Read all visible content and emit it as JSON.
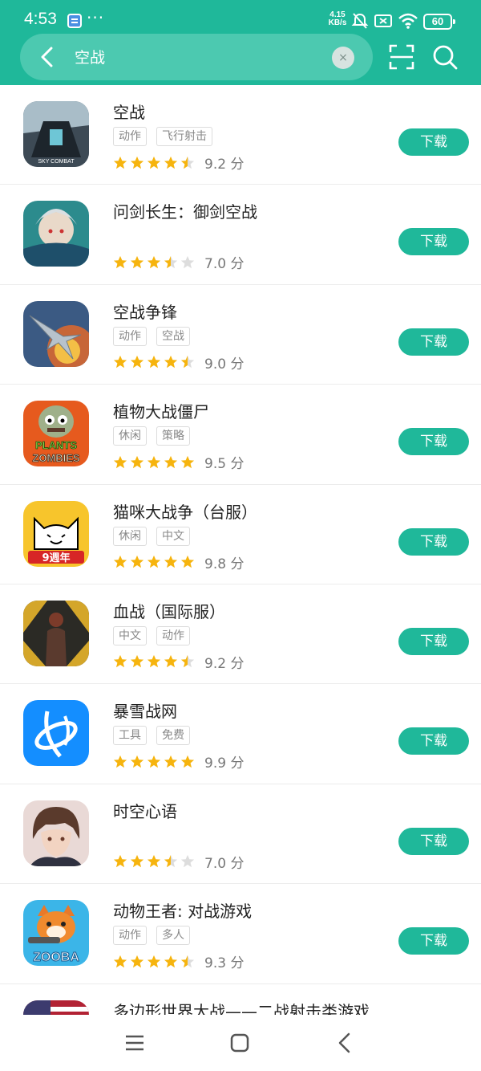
{
  "status_bar": {
    "time": "4:53",
    "dots": "···",
    "net_speed_value": "4.15",
    "net_speed_unit": "KB/s",
    "battery": "60"
  },
  "search": {
    "query": "空战",
    "clear_label": "×"
  },
  "colors": {
    "accent": "#1fb89a",
    "star_filled": "#f6b40e",
    "star_empty": "#dddddd"
  },
  "apps": [
    {
      "name": "空战",
      "tags": [
        "动作",
        "飞行射击"
      ],
      "rating_stars": 4.5,
      "score": "9.2 分",
      "button": "下载",
      "icon": "sky-combat-icon"
    },
    {
      "name": "问剑长生：御剑空战",
      "tags": [],
      "rating_stars": 3.5,
      "score": "7.0 分",
      "button": "下载",
      "icon": "wenjian-icon"
    },
    {
      "name": "空战争锋",
      "tags": [
        "动作",
        "空战"
      ],
      "rating_stars": 4.5,
      "score": "9.0 分",
      "button": "下载",
      "icon": "jet-fighter-icon"
    },
    {
      "name": "植物大战僵尸",
      "tags": [
        "休闲",
        "策略"
      ],
      "rating_stars": 5,
      "score": "9.5 分",
      "button": "下载",
      "icon": "plants-vs-zombies-icon"
    },
    {
      "name": "猫咪大战争（台服）",
      "tags": [
        "休闲",
        "中文"
      ],
      "rating_stars": 5,
      "score": "9.8 分",
      "button": "下载",
      "icon": "battle-cats-icon"
    },
    {
      "name": "血战（国际服）",
      "tags": [
        "中文",
        "动作"
      ],
      "rating_stars": 4.5,
      "score": "9.2 分",
      "button": "下载",
      "icon": "soldier-icon"
    },
    {
      "name": "暴雪战网",
      "tags": [
        "工具",
        "免费"
      ],
      "rating_stars": 5,
      "score": "9.9 分",
      "button": "下载",
      "icon": "battlenet-icon"
    },
    {
      "name": "时空心语",
      "tags": [],
      "rating_stars": 3.5,
      "score": "7.0 分",
      "button": "下载",
      "icon": "anime-portrait-icon"
    },
    {
      "name": "动物王者: 对战游戏",
      "tags": [
        "动作",
        "多人"
      ],
      "rating_stars": 4.5,
      "score": "9.3 分",
      "button": "下载",
      "icon": "zooba-icon"
    },
    {
      "name": "多边形世界大战——二战射击类游戏",
      "tags": [],
      "rating_stars": 0,
      "score": "",
      "button": "",
      "icon": "flag-icon"
    }
  ],
  "icon_art": {
    "sky_combat": "SKY COMBAT",
    "pvz_plants": "PLANTS",
    "pvz_zombies": "ZOMBIES",
    "battle_cats": "9週年",
    "zooba": "ZOOBA"
  }
}
